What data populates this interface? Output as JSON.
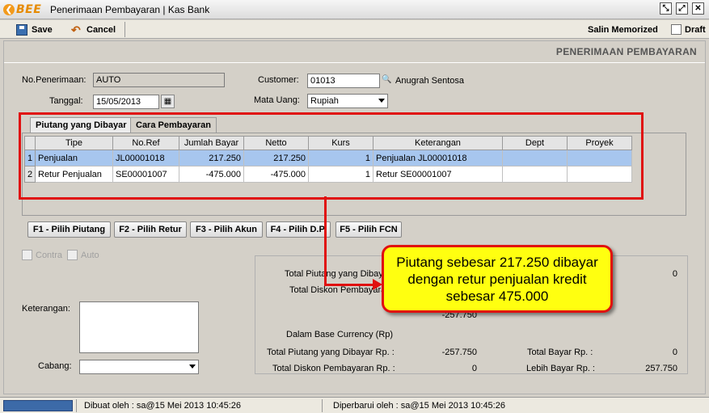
{
  "window": {
    "logo_text": "BEE",
    "title": "Penerimaan Pembayaran | Kas Bank"
  },
  "toolbar": {
    "save_label": "Save",
    "cancel_label": "Cancel",
    "salin_label": "Salin Memorized",
    "draft_label": "Draft"
  },
  "header": {
    "title": "PENERIMAAN PEMBAYARAN"
  },
  "form": {
    "no_penerimaan_label": "No.Penerimaan:",
    "no_penerimaan_value": "AUTO",
    "tanggal_label": "Tanggal:",
    "tanggal_value": "15/05/2013",
    "customer_label": "Customer:",
    "customer_value": "01013",
    "customer_name": "Anugrah Sentosa",
    "mata_uang_label": "Mata Uang:",
    "mata_uang_value": "Rupiah"
  },
  "tabs": [
    {
      "label": "Piutang yang Dibayar"
    },
    {
      "label": "Cara Pembayaran"
    }
  ],
  "grid": {
    "columns": [
      "Tipe",
      "No.Ref",
      "Jumlah Bayar",
      "Netto",
      "Kurs",
      "Keterangan",
      "Dept",
      "Proyek"
    ],
    "rows": [
      {
        "no": "1",
        "tipe": "Penjualan",
        "ref": "JL00001018",
        "jumlah": "217.250",
        "netto": "217.250",
        "kurs": "1",
        "ket": "Penjualan JL00001018",
        "dept": "",
        "proyek": ""
      },
      {
        "no": "2",
        "tipe": "Retur Penjualan",
        "ref": "SE00001007",
        "jumlah": "-475.000",
        "netto": "-475.000",
        "kurs": "1",
        "ket": "Retur SE00001007",
        "dept": "",
        "proyek": ""
      }
    ]
  },
  "buttons": {
    "f1": "F1 - Pilih Piutang",
    "f2": "F2 - Pilih Retur",
    "f3": "F3 - Pilih Akun",
    "f4": "F4 - Pilih D.P.",
    "f5": "F5 - Pilih FCN"
  },
  "options": {
    "contra_label": "Contra",
    "auto_label": "Auto"
  },
  "bottom": {
    "keterangan_label": "Keterangan:",
    "cabang_label": "Cabang:"
  },
  "summary": {
    "total_piutang_label": "Total Piutang yang Dibayar",
    "total_piutang_value": "0",
    "total_diskon_label": "Total Diskon Pembayaran",
    "partial_value": "-257.750",
    "base_currency_label": "Dalam Base Currency (Rp)",
    "total_piutang_rp_label": "Total Piutang yang Dibayar Rp. :",
    "total_piutang_rp_value": "-257.750",
    "total_diskon_rp_label": "Total Diskon Pembayaran Rp. :",
    "total_diskon_rp_value": "0",
    "total_bayar_rp_label": "Total Bayar Rp. :",
    "total_bayar_rp_value": "0",
    "lebih_bayar_rp_label": "Lebih Bayar Rp. :",
    "lebih_bayar_rp_value": "257.750"
  },
  "annotation": {
    "text": "Piutang sebesar 217.250 dibayar dengan retur penjualan kredit sebesar 475.000"
  },
  "status": {
    "dibuat": "Dibuat oleh : sa@15 Mei 2013  10:45:26",
    "diperbarui": "Diperbarui oleh : sa@15 Mei 2013  10:45:26"
  },
  "colors": {
    "highlight_red": "#e01010",
    "callout_yellow": "#ffff10",
    "selected_row": "#a7c6ee"
  }
}
